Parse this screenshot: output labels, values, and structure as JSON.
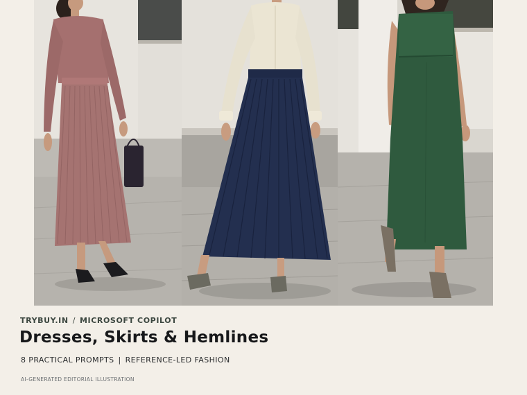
{
  "hero": {
    "panels": [
      {
        "outfit": "pleated pink knit dress"
      },
      {
        "outfit": "cream blouse with navy pleated skirt"
      },
      {
        "outfit": "green sleeveless midi dress"
      }
    ]
  },
  "meta": {
    "site": "TRYBUY.IN",
    "separator": "/",
    "tool": "MICROSOFT COPILOT"
  },
  "title": "Dresses, Skirts & Hemlines",
  "subtitle": {
    "left": "8 PRACTICAL PROMPTS",
    "separator": "|",
    "right": "REFERENCE-LED FASHION"
  },
  "footer": "AI-GENERATED EDITORIAL ILLUSTRATION",
  "colors": {
    "background": "#f3efe8",
    "pink_dress": "#a2706e",
    "navy_skirt": "#232f4f",
    "cream_blouse": "#ece7d6",
    "green_dress": "#2f5a3e"
  }
}
